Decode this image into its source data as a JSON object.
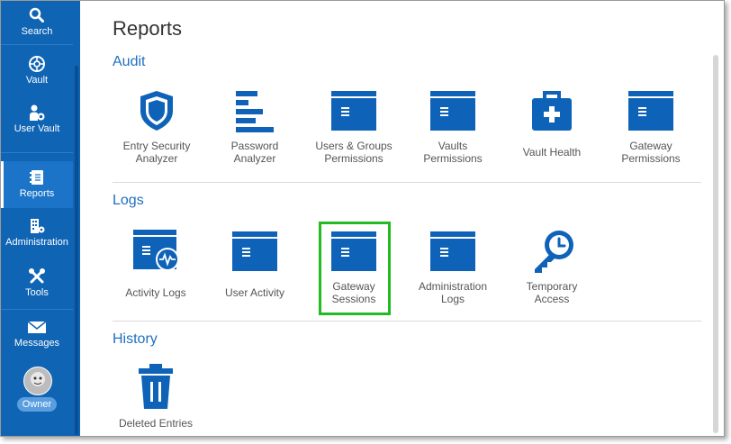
{
  "sidebar": {
    "items": [
      {
        "label": "Search",
        "icon": "search-icon"
      },
      {
        "label": "Vault",
        "icon": "vault-icon"
      },
      {
        "label": "User Vault",
        "icon": "user-vault-icon"
      },
      {
        "label": "Reports",
        "icon": "reports-icon"
      },
      {
        "label": "Administration",
        "icon": "administration-icon"
      },
      {
        "label": "Tools",
        "icon": "tools-icon"
      },
      {
        "label": "Messages",
        "icon": "mail-icon"
      }
    ],
    "active": "Reports",
    "owner_badge": "Owner"
  },
  "page": {
    "title": "Reports"
  },
  "sections": {
    "audit": {
      "title": "Audit",
      "tiles": [
        {
          "line1": "Entry Security",
          "line2": "Analyzer",
          "icon": "shield-icon"
        },
        {
          "line1": "Password",
          "line2": "Analyzer",
          "icon": "bar-list-icon"
        },
        {
          "line1": "Users & Groups",
          "line2": "Permissions",
          "icon": "window-icon"
        },
        {
          "line1": "Vaults",
          "line2": "Permissions",
          "icon": "window-icon"
        },
        {
          "line1": "Vault Health",
          "line2": "",
          "icon": "medical-kit-icon"
        },
        {
          "line1": "Gateway",
          "line2": "Permissions",
          "icon": "window-icon"
        }
      ]
    },
    "logs": {
      "title": "Logs",
      "tiles": [
        {
          "line1": "Activity Logs",
          "line2": "",
          "icon": "activity-window-icon"
        },
        {
          "line1": "User Activity",
          "line2": "",
          "icon": "window-icon"
        },
        {
          "line1": "Gateway",
          "line2": "Sessions",
          "icon": "window-icon"
        },
        {
          "line1": "Administration",
          "line2": "Logs",
          "icon": "window-icon"
        },
        {
          "line1": "Temporary",
          "line2": "Access",
          "icon": "key-clock-icon"
        }
      ]
    },
    "history": {
      "title": "History",
      "tiles": [
        {
          "line1": "Deleted Entries",
          "line2": "",
          "icon": "trash-icon"
        }
      ]
    }
  },
  "colors": {
    "sidebar": "#0f64b4",
    "icon": "#0e63b8",
    "accent_text": "#1f6fc0",
    "highlight": "#22bb22"
  }
}
